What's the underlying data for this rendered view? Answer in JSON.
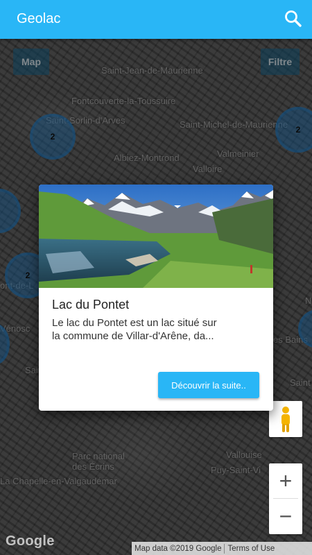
{
  "app": {
    "title": "Geolac"
  },
  "map_controls": {
    "map_label": "Map",
    "filter_label": "Filtre"
  },
  "towns": [
    "Saint-Jean-de-Maurienne",
    "Fontcouverte-la-Toussuire",
    "Saint-Sorlin-d'Arves",
    "Saint-Michel-de-Maurienne",
    "Albiez-Montrond",
    "Valmeinier",
    "Valloire",
    "ont-de-L",
    "Vénosc",
    "Saint",
    "es Bains",
    "Saint",
    "Parc national des Écrins",
    "Vallouise",
    "Puy-Saint-Vi",
    "La Chapelle-en-Valgaudémar",
    "N"
  ],
  "clusters": [
    "2",
    "2",
    "2"
  ],
  "dialog": {
    "title": "Lac du Pontet",
    "description": "Le lac du Pontet est un lac situé sur la commune de Villar-d'Arêne, da...",
    "button": "Découvrir la suite.."
  },
  "footer": {
    "google": "Google",
    "map_data": "Map data ©2019 Google",
    "terms": "Terms of Use"
  },
  "zoom": {
    "in": "+",
    "out": "−"
  },
  "colors": {
    "primary": "#29b6f6",
    "cluster": "#2196f3"
  }
}
